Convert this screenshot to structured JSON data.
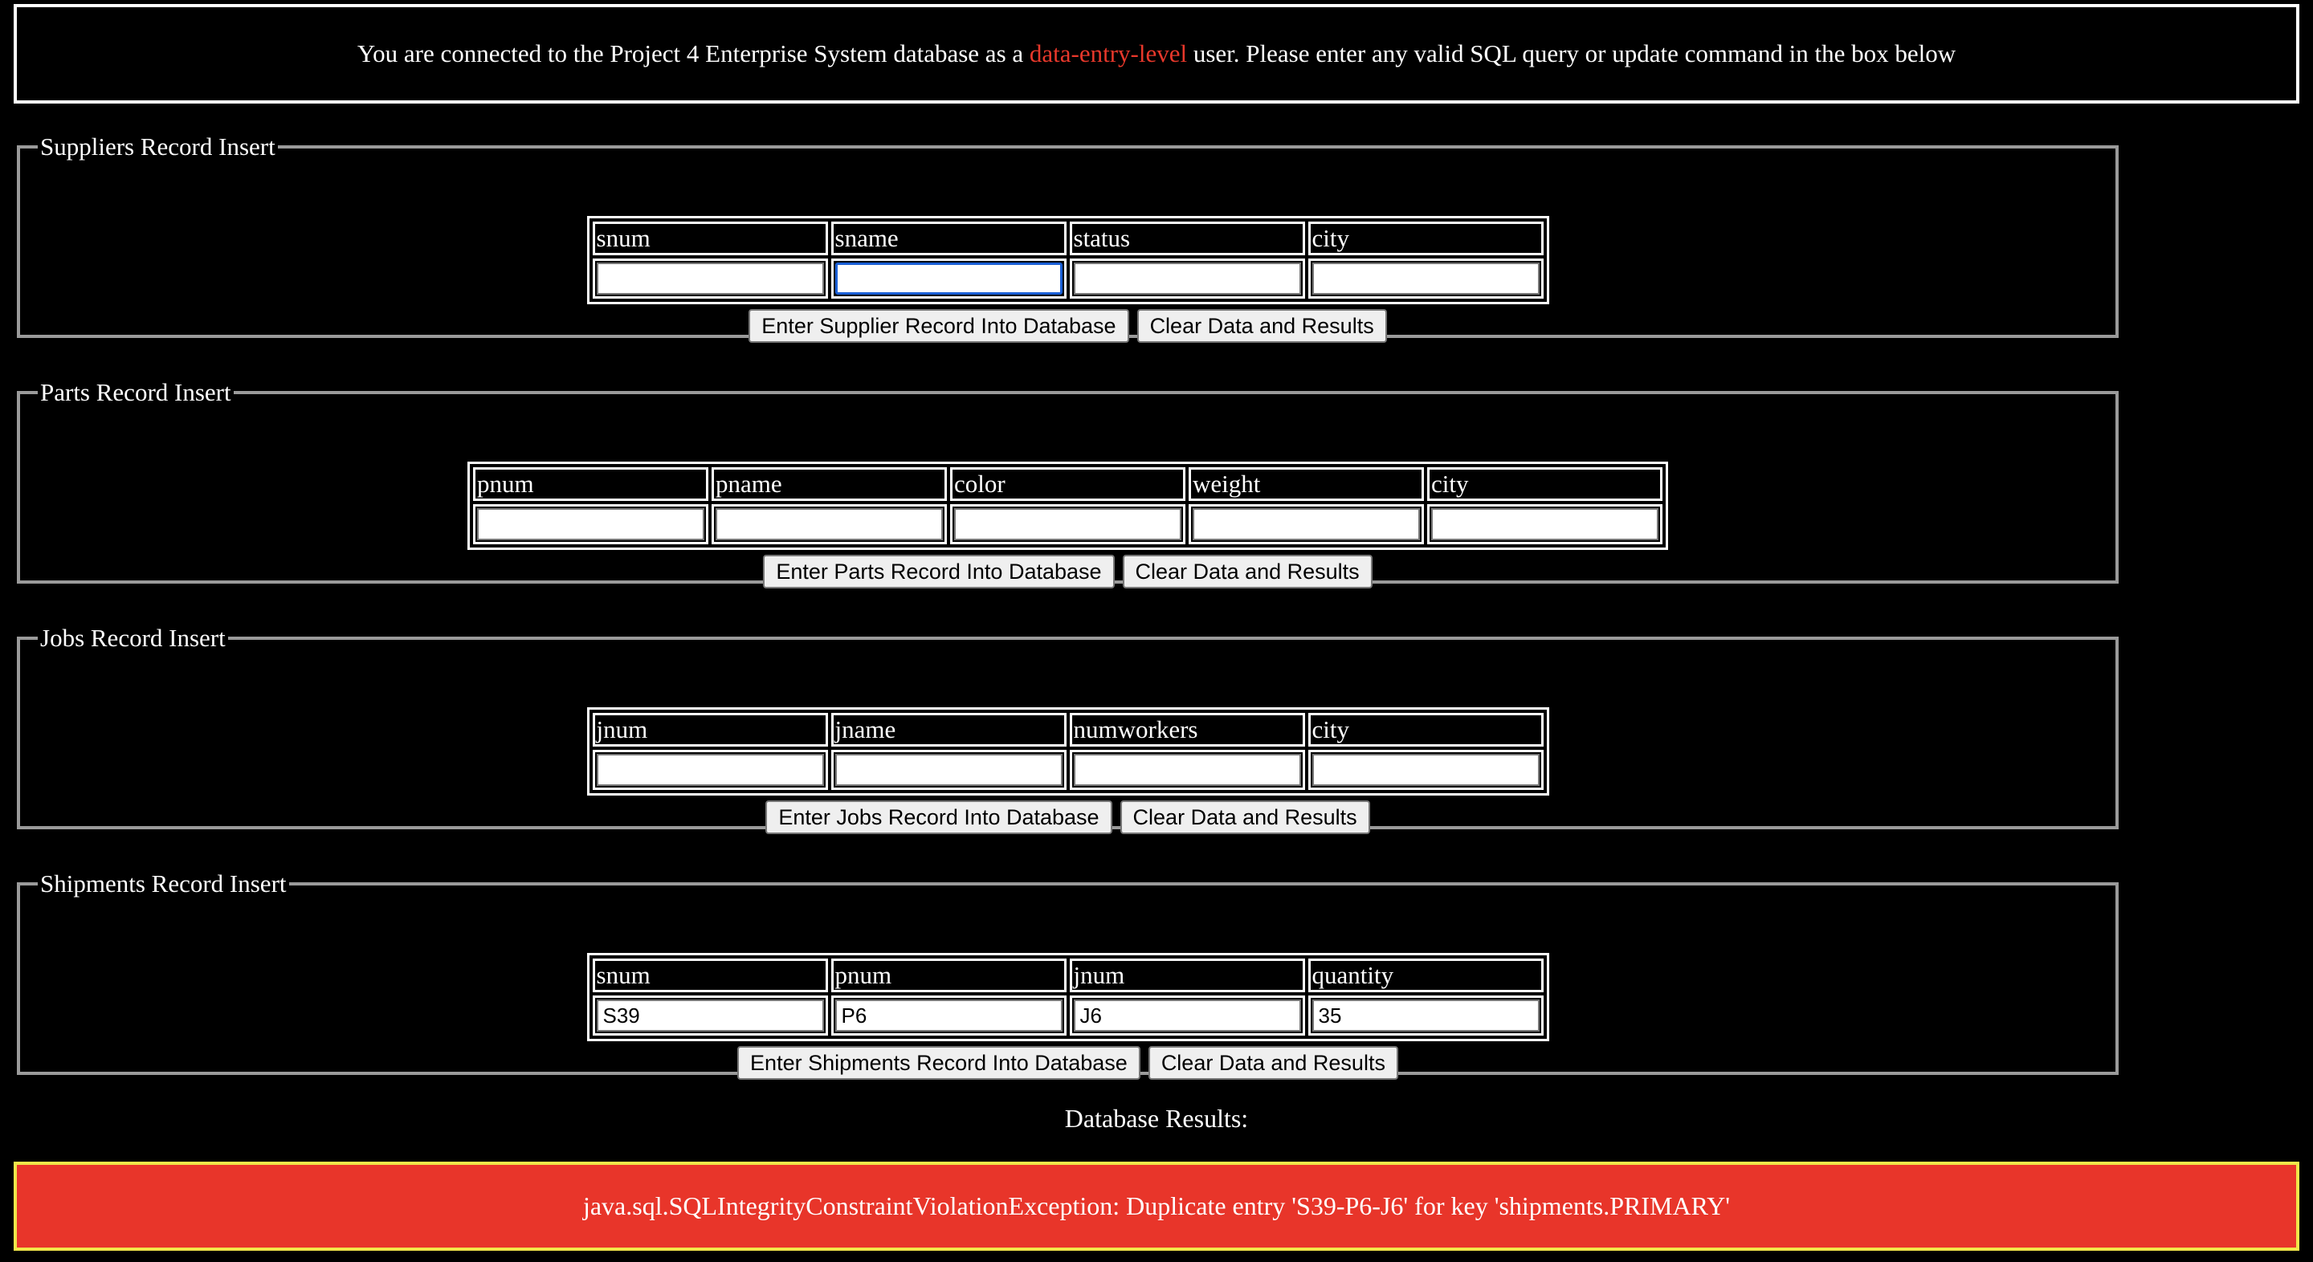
{
  "header": {
    "prefix": "You are connected to the Project 4 Enterprise System database as a ",
    "role": "data-entry-level",
    "suffix": " user. Please enter any valid SQL query or update command in the box below"
  },
  "suppliers": {
    "legend": "Suppliers Record Insert",
    "columns": [
      "snum",
      "sname",
      "status",
      "city"
    ],
    "values": [
      "",
      "",
      "",
      ""
    ],
    "submit_label": "Enter Supplier Record Into Database",
    "clear_label": "Clear Data and Results"
  },
  "parts": {
    "legend": "Parts Record Insert",
    "columns": [
      "pnum",
      "pname",
      "color",
      "weight",
      "city"
    ],
    "values": [
      "",
      "",
      "",
      "",
      ""
    ],
    "submit_label": "Enter Parts Record Into Database",
    "clear_label": "Clear Data and Results"
  },
  "jobs": {
    "legend": "Jobs Record Insert",
    "columns": [
      "jnum",
      "jname",
      "numworkers",
      "city"
    ],
    "values": [
      "",
      "",
      "",
      ""
    ],
    "submit_label": "Enter Jobs Record Into Database",
    "clear_label": "Clear Data and Results"
  },
  "shipments": {
    "legend": "Shipments Record Insert",
    "columns": [
      "snum",
      "pnum",
      "jnum",
      "quantity"
    ],
    "values": [
      "S39",
      "P6",
      "J6",
      "35"
    ],
    "submit_label": "Enter Shipments Record Into Database",
    "clear_label": "Clear Data and Results"
  },
  "results": {
    "label": "Database Results:",
    "message": "java.sql.SQLIntegrityConstraintViolationException: Duplicate entry 'S39-P6-J6' for key 'shipments.PRIMARY'"
  },
  "colors": {
    "background": "#000000",
    "role_highlight": "#e8382b",
    "error_background": "#e8352a",
    "error_border": "#f2e64a"
  }
}
